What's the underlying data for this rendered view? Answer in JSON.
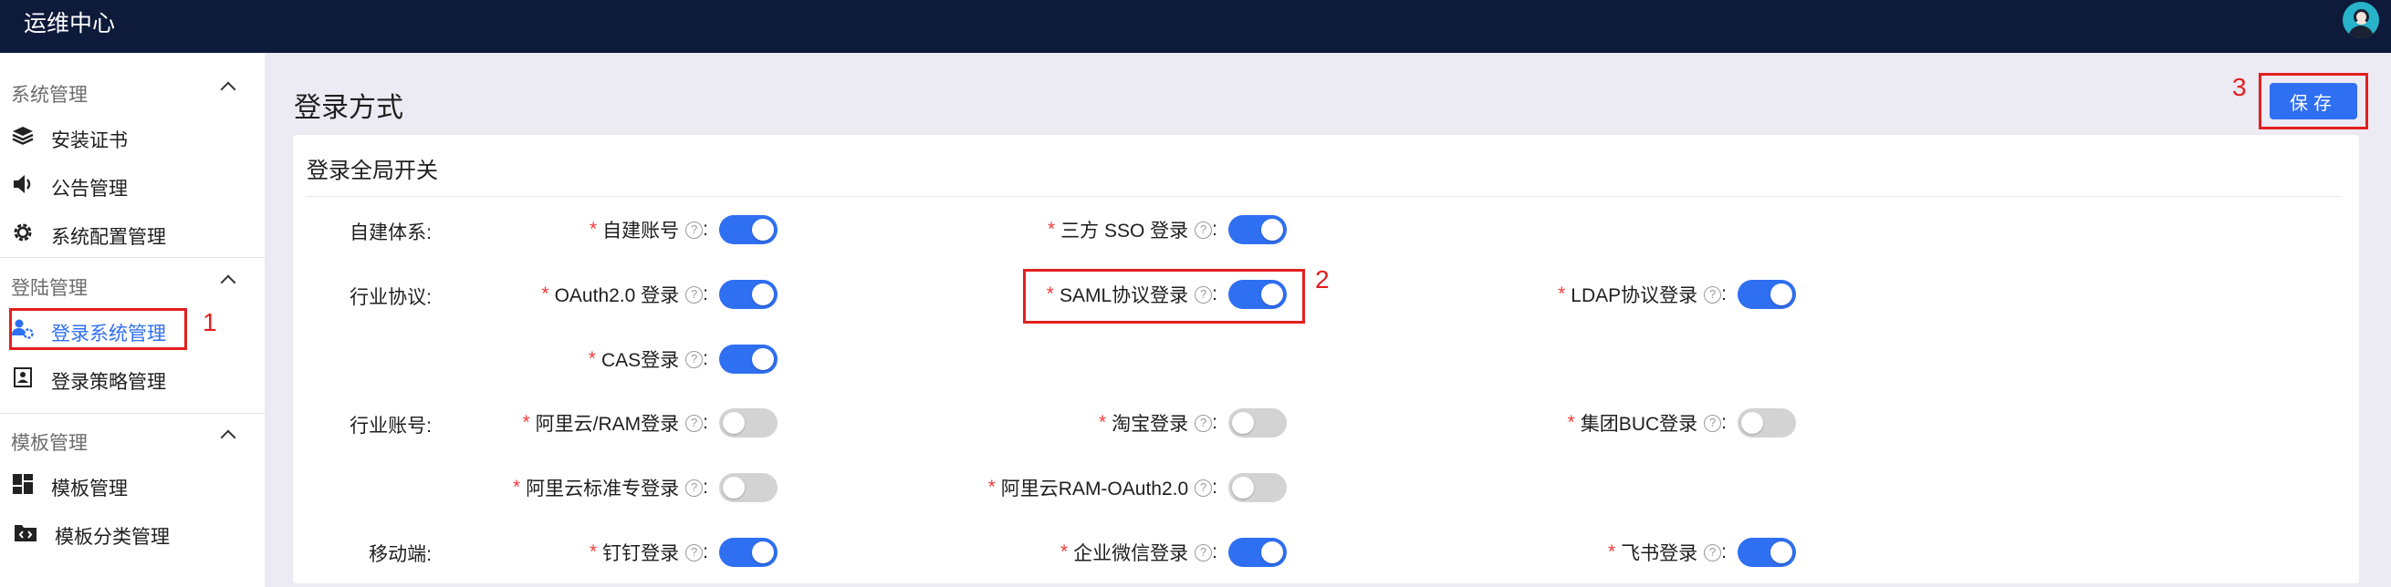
{
  "app": {
    "title": "运维中心"
  },
  "sidebar": {
    "groups": [
      {
        "title": "系统管理",
        "items": [
          {
            "label": "安装证书",
            "icon": "layers-icon"
          },
          {
            "label": "公告管理",
            "icon": "speaker-icon"
          },
          {
            "label": "系统配置管理",
            "icon": "gear-icon"
          }
        ]
      },
      {
        "title": "登陆管理",
        "items": [
          {
            "label": "登录系统管理",
            "icon": "user-gear-icon",
            "active": true
          },
          {
            "label": "登录策略管理",
            "icon": "contact-card-icon"
          }
        ]
      },
      {
        "title": "模板管理",
        "items": [
          {
            "label": "模板管理",
            "icon": "dashboard-icon"
          },
          {
            "label": "模板分类管理",
            "icon": "code-folder-icon"
          }
        ]
      }
    ]
  },
  "main": {
    "title": "登录方式",
    "save_label": "保存",
    "card_title": "登录全局开关",
    "rows": [
      {
        "label": "自建体系:",
        "fields": [
          {
            "label": "自建账号",
            "on": true
          },
          {
            "label": "三方 SSO 登录",
            "on": true
          }
        ]
      },
      {
        "label": "行业协议:",
        "fields": [
          {
            "label": "OAuth2.0 登录",
            "on": true
          },
          {
            "label": "SAML协议登录",
            "on": true
          },
          {
            "label": "LDAP协议登录",
            "on": true
          },
          {
            "label": "CAS登录",
            "on": true
          }
        ]
      },
      {
        "label": "行业账号:",
        "fields": [
          {
            "label": "阿里云/RAM登录",
            "on": false
          },
          {
            "label": "淘宝登录",
            "on": false
          },
          {
            "label": "集团BUC登录",
            "on": false
          },
          {
            "label": "阿里云标准专登录",
            "on": false
          },
          {
            "label": "阿里云RAM-OAuth2.0",
            "on": false
          }
        ]
      },
      {
        "label": "移动端:",
        "fields": [
          {
            "label": "钉钉登录",
            "on": true
          },
          {
            "label": "企业微信登录",
            "on": true
          },
          {
            "label": "飞书登录",
            "on": true
          }
        ]
      }
    ],
    "required_mark": "*",
    "help_glyph": "?",
    "colon": ":"
  },
  "annotations": {
    "one": "1",
    "two": "2",
    "three": "3"
  },
  "colors": {
    "topbar": "#0e1a3a",
    "accent": "#2f6ff2",
    "annotation": "#e21f1f",
    "required": "#f23c3c"
  }
}
